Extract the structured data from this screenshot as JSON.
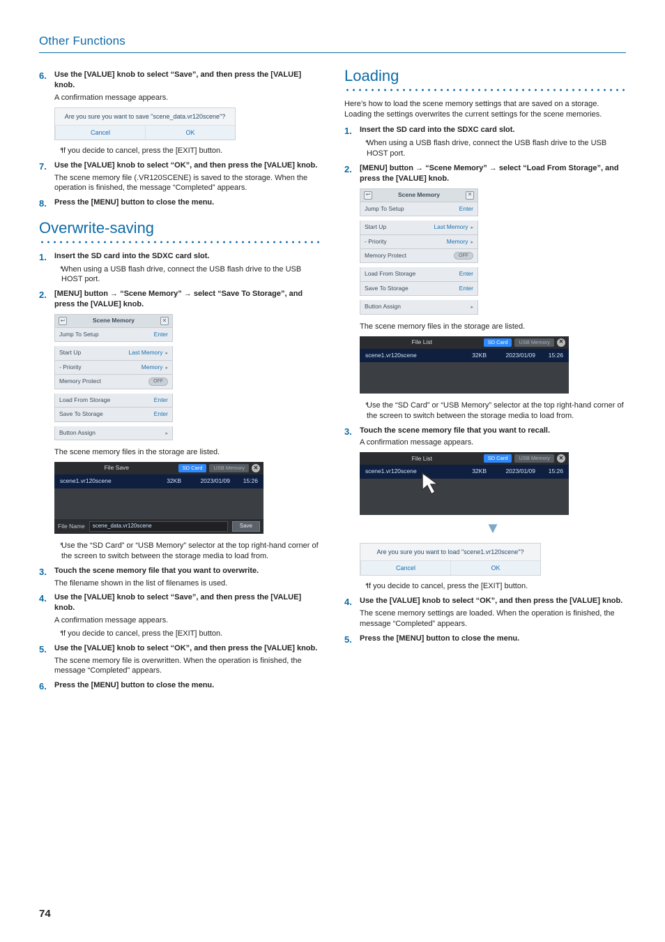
{
  "header": {
    "title": "Other Functions"
  },
  "page_number": "74",
  "confirm_dialog_save": {
    "message": "Are you sure you want to save \"scene_data.vr120scene\"?",
    "cancel": "Cancel",
    "ok": "OK"
  },
  "confirm_dialog_load": {
    "message": "Are you sure you want to load \"scene1.vr120scene\"?",
    "cancel": "Cancel",
    "ok": "OK"
  },
  "scene_panel": {
    "title": "Scene Memory",
    "rows": {
      "jump": {
        "label": "Jump To Setup",
        "value": "Enter"
      },
      "startup": {
        "label": "Start Up",
        "value": "Last Memory"
      },
      "priority": {
        "label": "- Priority",
        "value": "Memory"
      },
      "protect": {
        "label": "Memory Protect",
        "value": "OFF"
      },
      "load": {
        "label": "Load From Storage",
        "value": "Enter"
      },
      "save": {
        "label": "Save To Storage",
        "value": "Enter"
      },
      "assign": {
        "label": "Button Assign",
        "value": ""
      }
    }
  },
  "file_list": {
    "title": "File List",
    "save_title": "File Save",
    "chip_sd": "SD Card",
    "chip_usb": "USB Memory",
    "row": {
      "name": "scene1.vr120scene",
      "size": "32KB",
      "date": "2023/01/09",
      "time": "15:26"
    },
    "file_name_label": "File Name",
    "file_name_value": "scene_data.vr120scene",
    "save_btn": "Save"
  },
  "left": {
    "step6": {
      "title": "Use the [VALUE] knob to select “Save”, and then press the [VALUE] knob.",
      "line1": "A confirmation message appears.",
      "note": "If you decide to cancel, press the [EXIT] button."
    },
    "step7": {
      "title": "Use the [VALUE] knob to select “OK”, and then press the [VALUE] knob.",
      "line1": "The scene memory file (.VR120SCENE) is saved to the storage. When the operation is finished, the message “Completed” appears."
    },
    "step8": {
      "title": "Press the [MENU] button to close the menu."
    },
    "section2_title": "Overwrite-saving",
    "ow1": {
      "title": "Insert the SD card into the SDXC card slot.",
      "note": "When using a USB flash drive, connect the USB flash drive to the USB HOST port."
    },
    "ow2": {
      "title_pre": "[MENU] button ",
      "title_mid": " “Scene Memory” ",
      "title_post": " select “Save To Storage”, and press the [VALUE] knob.",
      "line1": "The scene memory files in the storage are listed.",
      "note": "Use the “SD Card” or “USB Memory” selector at the top right-hand corner of the screen to switch between the storage media to load from."
    },
    "ow3": {
      "title": "Touch the scene memory file that you want to overwrite.",
      "line1": "The filename shown in the list of filenames is used."
    },
    "ow4": {
      "title": "Use the [VALUE] knob to select “Save”, and then press the [VALUE] knob.",
      "line1": "A confirmation message appears.",
      "note": "If you decide to cancel, press the [EXIT] button."
    },
    "ow5": {
      "title": "Use the [VALUE] knob to select “OK”, and then press the [VALUE] knob.",
      "line1": "The scene memory file is overwritten. When the operation is finished, the message “Completed” appears."
    },
    "ow6": {
      "title": "Press the [MENU] button to close the menu."
    }
  },
  "right": {
    "section_title": "Loading",
    "intro": "Here’s how to load the scene memory settings that are saved on a storage. Loading the settings overwrites the current settings for the scene memories.",
    "ld1": {
      "title": "Insert the SD card into the SDXC card slot.",
      "note": "When using a USB flash drive, connect the USB flash drive to the USB HOST port."
    },
    "ld2": {
      "title_pre": "[MENU] button ",
      "title_mid": " “Scene Memory” ",
      "title_post": " select “Load From Storage”, and press the [VALUE] knob.",
      "line1": "The scene memory files in the storage are listed.",
      "note": "Use the “SD Card” or “USB Memory” selector at the top right-hand corner of the screen to switch between the storage media to load from."
    },
    "ld3": {
      "title": "Touch the scene memory file that you want to recall.",
      "line1": "A confirmation message appears.",
      "note": "If you decide to cancel, press the [EXIT] button."
    },
    "ld4": {
      "title": "Use the [VALUE] knob to select “OK”, and then press the [VALUE] knob.",
      "line1": "The scene memory settings are loaded. When the operation is finished, the message “Completed” appears."
    },
    "ld5": {
      "title": "Press the [MENU] button to close the menu."
    }
  },
  "arrow": "→"
}
